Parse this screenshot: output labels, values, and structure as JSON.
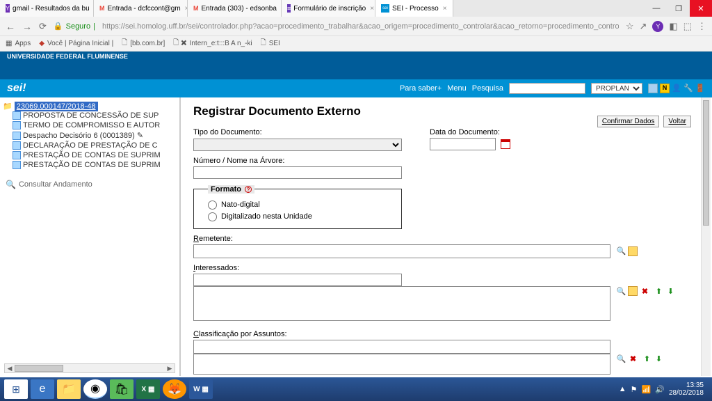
{
  "browser": {
    "tabs": [
      {
        "icon": "Y",
        "iconBg": "#6c2db4",
        "label": "gmail - Resultados da bu"
      },
      {
        "icon": "M",
        "iconBg": "#ea4335",
        "label": "Entrada - dcfccont@gm"
      },
      {
        "icon": "M",
        "iconBg": "#ea4335",
        "label": "Entrada (303) - edsonba"
      },
      {
        "icon": "≡",
        "iconBg": "#673ab7",
        "label": "Formulário de inscrição"
      },
      {
        "icon": "sei",
        "iconBg": "#0091d4",
        "label": "SEI - Processo",
        "active": true
      }
    ],
    "secure": "Seguro",
    "url": "https://sei.homolog.uff.br/sei/controlador.php?acao=procedimento_trabalhar&acao_origem=procedimento_controlar&acao_retorno=procedimento_controlar&...",
    "bookmarks": {
      "apps": "Apps",
      "items": [
        "Você | Página Inicial |",
        "[bb.com.br]",
        "Intern_e:t:::B A n_-ki",
        "SEI"
      ]
    }
  },
  "header": {
    "org": "UNIVERSIDADE FEDERAL FLUMINENSE",
    "logo": "sei!",
    "links": {
      "saber": "Para saber+",
      "menu": "Menu",
      "pesquisa": "Pesquisa"
    },
    "unit": "PROPLAN",
    "nBadge": "N"
  },
  "tree": {
    "process": "23069.000147/2018-48",
    "docs": [
      "PROPOSTA DE CONCESSÃO DE SUP",
      "TERMO DE COMPROMISSO E AUTOR",
      "Despacho Decisório 6 (0001389)  ✎",
      "DECLARAÇÃO DE PRESTAÇÃO DE C",
      "PRESTAÇÃO DE CONTAS DE SUPRIM",
      "PRESTAÇÃO DE CONTAS DE SUPRIM"
    ],
    "consultar": "Consultar Andamento"
  },
  "form": {
    "title": "Registrar Documento Externo",
    "actions": {
      "confirmar": "Confirmar Dados",
      "voltar": "Voltar"
    },
    "labels": {
      "tipo": "Tipo do Documento:",
      "data": "Data do Documento:",
      "numero": "Número / Nome na Árvore:",
      "formato": "Formato",
      "nato": "Nato-digital",
      "digit": "Digitalizado nesta Unidade",
      "remetente_pre": "R",
      "remetente_rest": "emetente:",
      "interessados_pre": "I",
      "interessados_rest": "nteressados:",
      "classif_pre": "C",
      "classif_rest": "lassificação por Assuntos:",
      "help": "?"
    }
  },
  "taskbar": {
    "excel": "X ▦",
    "word": "W ▦",
    "time": "13:35",
    "date": "28/02/2018"
  }
}
